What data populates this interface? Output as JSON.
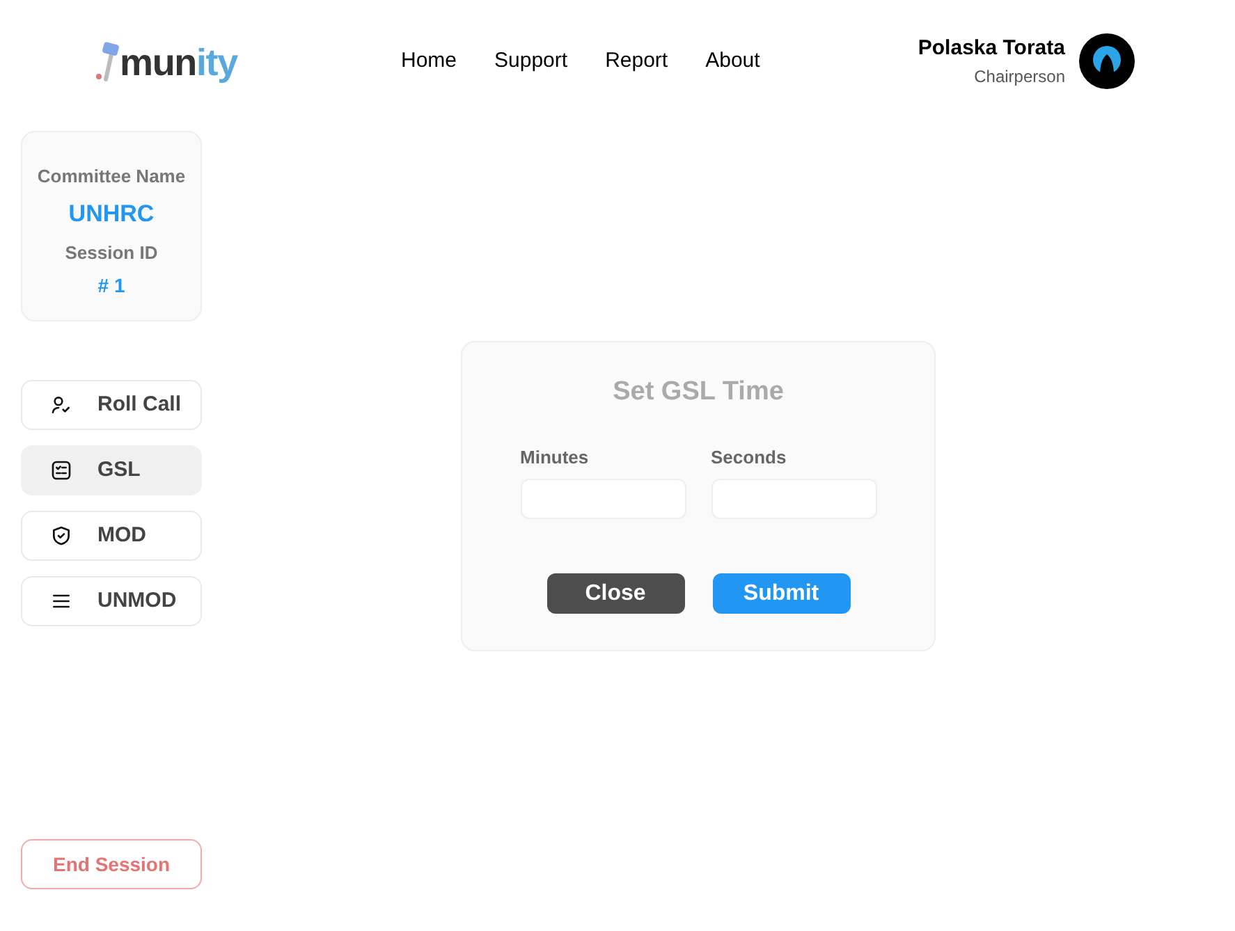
{
  "logo": {
    "main": "mun",
    "accent": "ity"
  },
  "nav": [
    "Home",
    "Support",
    "Report",
    "About"
  ],
  "user": {
    "name": "Polaska Torata",
    "role": "Chairperson"
  },
  "committee": {
    "name_label": "Committee Name",
    "name": "UNHRC",
    "session_label": "Session ID",
    "session": "# 1"
  },
  "sidebar": {
    "items": [
      {
        "label": "Roll Call",
        "selected": false
      },
      {
        "label": "GSL",
        "selected": true
      },
      {
        "label": "MOD",
        "selected": false
      },
      {
        "label": "UNMOD",
        "selected": false
      }
    ],
    "end_button": "End Session"
  },
  "dialog": {
    "title": "Set GSL Time",
    "fields": [
      {
        "label": "Minutes"
      },
      {
        "label": "Seconds"
      }
    ],
    "buttons": [
      {
        "label": "Close",
        "kind": "secondary"
      },
      {
        "label": "Submit",
        "kind": "primary"
      }
    ]
  }
}
